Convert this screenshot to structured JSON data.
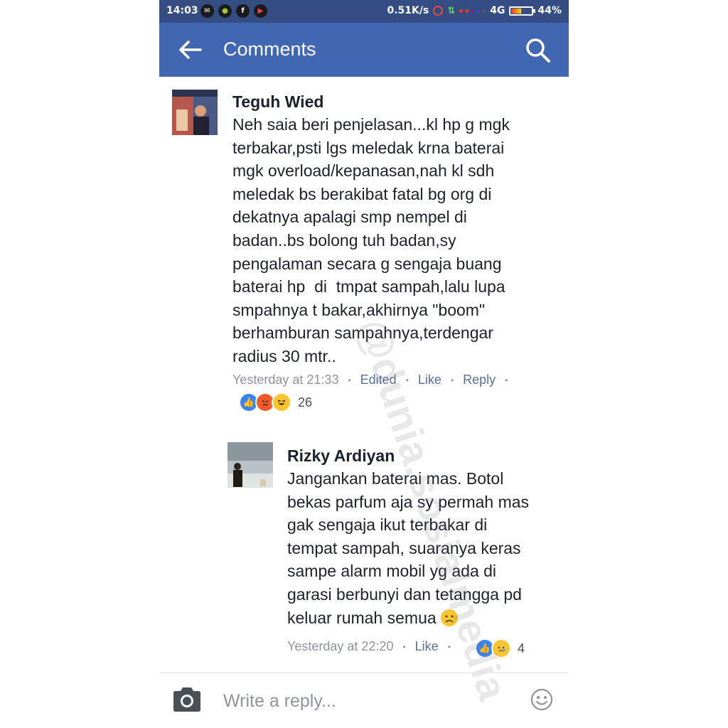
{
  "status_bar": {
    "time": "14:03",
    "speed": "0.51K/s",
    "network": "4G",
    "battery": "44%",
    "battery_level": 0.44
  },
  "app_bar": {
    "title": "Comments",
    "back_icon": "arrow-left-icon",
    "search_icon": "search-icon"
  },
  "comments": [
    {
      "author": "Teguh Wied",
      "text": "Neh saia beri penjelasan...kl hp g mgk\nterbakar,psti lgs meledak krna baterai\nmgk overload/kepanasan,nah kl sdh\nmeledak bs berakibat fatal bg org di\ndekatnya apalagi smp nempel di\nbadan..bs bolong tuh badan,sy\npengalaman secara g sengaja buang\nbaterai hp  di  tmpat sampah,lalu lupa\nsmpahnya t bakar,akhirnya \"boom\"\nberhamburan sampahnya,terdengar\nradius 30 mtr..",
      "timestamp": "Yesterday at 21:33",
      "edited_label": "Edited",
      "like_label": "Like",
      "reply_label": "Reply",
      "reaction_count": "26",
      "reactions": [
        "like",
        "angry",
        "haha"
      ]
    },
    {
      "author": "Rizky Ardiyan",
      "text": "Jangankan baterai mas. Botol\nbekas parfum aja sy permah mas\ngak sengaja ikut terbakar di\ntempat sampah, suaranya keras\nsampe alarm mobil yg ada di\ngarasi berbunyi dan tetangga pd\nkeluar rumah semua",
      "timestamp": "Yesterday at 22:20",
      "like_label": "Like",
      "reaction_count": "4",
      "reactions": [
        "like",
        "sad"
      ]
    }
  ],
  "composer": {
    "placeholder": "Write a reply...",
    "camera_icon": "camera-icon",
    "emoji_icon": "smiley-icon"
  },
  "colors": {
    "status_bar": "#344d82",
    "app_bar": "#4267b2",
    "link": "#5b6f93",
    "meta": "#90949c"
  }
}
